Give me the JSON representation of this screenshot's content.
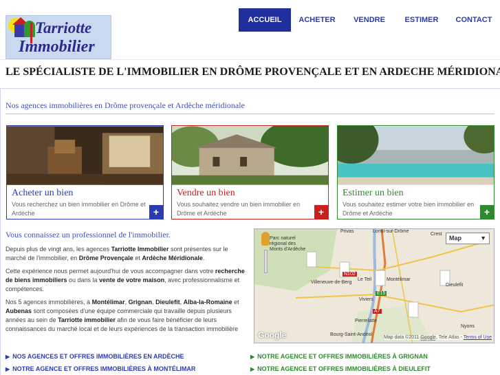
{
  "brand": {
    "logo_line1": "Tarriotte",
    "logo_line2": "Immobilier"
  },
  "nav": {
    "items": [
      {
        "label": "ACCUEIL",
        "active": true
      },
      {
        "label": "ACHETER",
        "active": false
      },
      {
        "label": "VENDRE",
        "active": false
      },
      {
        "label": "ESTIMER",
        "active": false
      },
      {
        "label": "CONTACT",
        "active": false
      }
    ]
  },
  "tagline": "LE SPÉCIALISTE DE L'IMMOBILIER EN DRÔME PROVENÇALE ET EN ARDECHE MÉRIDIONALE",
  "subtitle": "Nos agences immobilières en Drôme provençale et Ardèche méridionale",
  "cards": [
    {
      "title": "Acheter un bien",
      "text": "Vous recherchez un bien immobilier en Drôme et Ardèche",
      "plus": "+",
      "color": "#2b3bb0"
    },
    {
      "title": "Vendre un bien",
      "text": "Vous souhaitez vendre un bien immobilier en Drôme et Ardèche",
      "plus": "+",
      "color": "#c8201f"
    },
    {
      "title": "Estimer un bien",
      "text": "Vous souhaitez estimer votre bien immobilier en Drôme et Ardèche",
      "plus": "+",
      "color": "#2f8a2f"
    }
  ],
  "pro": {
    "heading": "Vous connaissez un professionnel de l'immobilier.",
    "p1": {
      "a": "Depuis plus de vingt ans, les agences ",
      "b": "Tarriotte Immobilier",
      "c": " sont présentes sur le marché de l'immobilier, en ",
      "d": "Drôme Provençale",
      "e": " et ",
      "f": "Ardèche Méridionale",
      "g": "."
    },
    "p2": {
      "a": "Cette expérience nous permet aujourd'hui de vous accompagner dans votre ",
      "b": "recherche de biens immobiliers",
      "c": " ou dans la ",
      "d": "vente de votre maison",
      "e": ", avec professionnalisme et compétences."
    },
    "p3": {
      "a": "Nos 5 agences immobilières, à ",
      "b": "Montélimar",
      "c": ", ",
      "d": "Grignan",
      "e": ", ",
      "f": "Dieulefit",
      "g": ", ",
      "h": "Alba-la-Romaine",
      "i": " et ",
      "j": "Aubenas",
      "k": " sont composées d'une équipe commerciale qui travaille depuis plusieurs années au sein de ",
      "l": "Tarriotte immobilier",
      "m": " afin de vous faire bénéficier de leurs connaissances du marché local et de leurs expériences de la transaction immobilière"
    }
  },
  "map": {
    "type_label": "Map",
    "dropdown_arrow": "▼",
    "google": "Google",
    "credit": "Map data ©2011 Google, Tele Atlas -",
    "terms": "Terms of Use",
    "places": [
      "Parc naturel",
      "régional des",
      "Monts d'Ardèche",
      "Privas",
      "Loriol-sur-Drôme",
      "Crest",
      "Villeneuve-de-Berg",
      "Le Teil",
      "Montélimar",
      "Viviers",
      "Dieulefit",
      "Pierrelatte",
      "Bourg-Saint-Andéol",
      "Nyons",
      "Valréas"
    ],
    "roads": [
      "N102",
      "A7",
      "E15"
    ]
  },
  "links": [
    {
      "label": "NOS AGENCES ET OFFRES IMMOBILIÈRES EN ARDÈCHE",
      "color": "#2b3bb0"
    },
    {
      "label": "NOTRE AGENCE ET OFFRES IMMOBILIÈRES À GRIGNAN",
      "color": "#2f8a2f"
    },
    {
      "label": "NOTRE AGENCE ET OFFRES IMMOBILIÈRES À MONTÉLIMAR",
      "color": "#2b3bb0"
    },
    {
      "label": "NOTRE AGENCE ET OFFRES IMMOBILIÈRES À DIEULEFIT",
      "color": "#2f8a2f"
    }
  ],
  "link_arrow": "▶",
  "icons": {
    "plus": "plus-icon",
    "arrow": "triangle-right-icon",
    "pegman": "pegman-icon"
  }
}
